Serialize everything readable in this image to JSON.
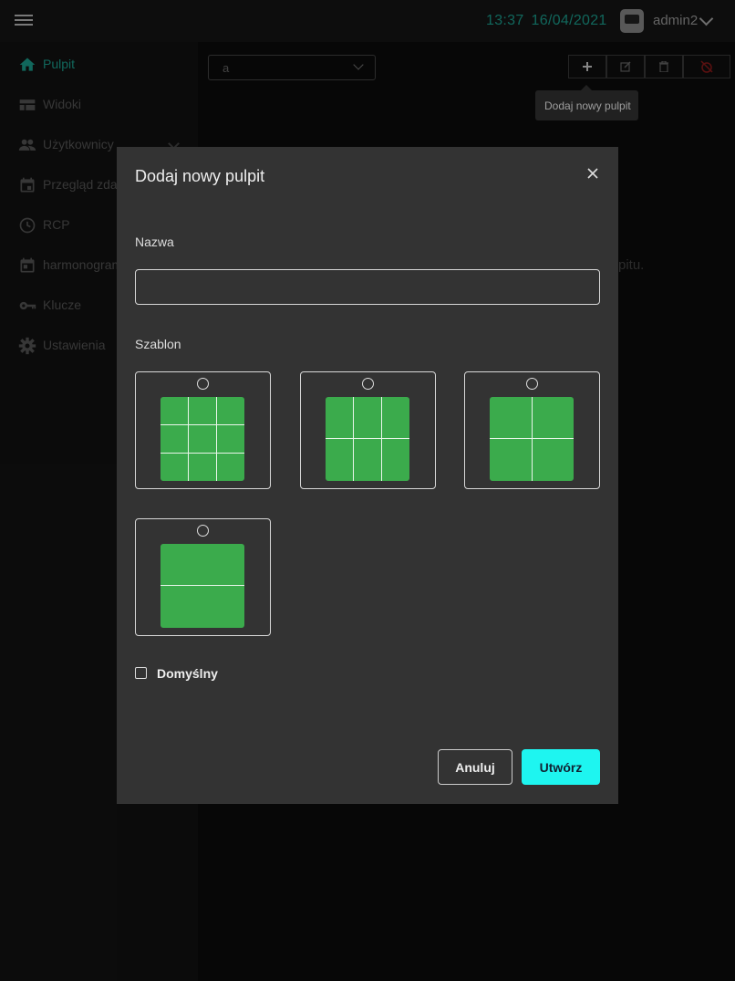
{
  "header": {
    "time": "13:37",
    "date": "16/04/2021",
    "username": "admin2",
    "accent_color": "#1b9e8e"
  },
  "sidebar": {
    "items": [
      {
        "label": "Pulpit",
        "icon": "home-icon",
        "active": true
      },
      {
        "label": "Widoki",
        "icon": "view-quilt-icon"
      },
      {
        "label": "Użytkownicy",
        "icon": "people-icon",
        "expandable": true
      },
      {
        "label": "Przegląd zdarzeń",
        "icon": "calendar-icon"
      },
      {
        "label": "RCP",
        "icon": "clock-icon"
      },
      {
        "label": "harmonogram",
        "icon": "calendar-icon"
      },
      {
        "label": "Klucze",
        "icon": "key-icon"
      },
      {
        "label": "Ustawienia",
        "icon": "gear-icon"
      }
    ]
  },
  "toolbar": {
    "dashboard_select_value": "a",
    "buttons": [
      "plus-icon",
      "edit-icon",
      "trash-icon",
      "alarm-off-icon"
    ],
    "tooltip": "Dodaj nowy pulpit"
  },
  "background_hint": "pitu.",
  "modal": {
    "title": "Dodaj nowy pulpit",
    "name_label": "Nazwa",
    "name_value": "",
    "template_label": "Szablon",
    "templates": [
      {
        "layout": "3x3",
        "selected": false
      },
      {
        "layout": "3x2",
        "selected": false
      },
      {
        "layout": "2x2",
        "selected": false
      },
      {
        "layout": "1x2",
        "selected": false
      }
    ],
    "template_color": "#3bab4c",
    "default_checkbox_label": "Domyślny",
    "default_checked": false,
    "cancel_label": "Anuluj",
    "create_label": "Utwórz",
    "create_color": "#1ef5f0"
  }
}
